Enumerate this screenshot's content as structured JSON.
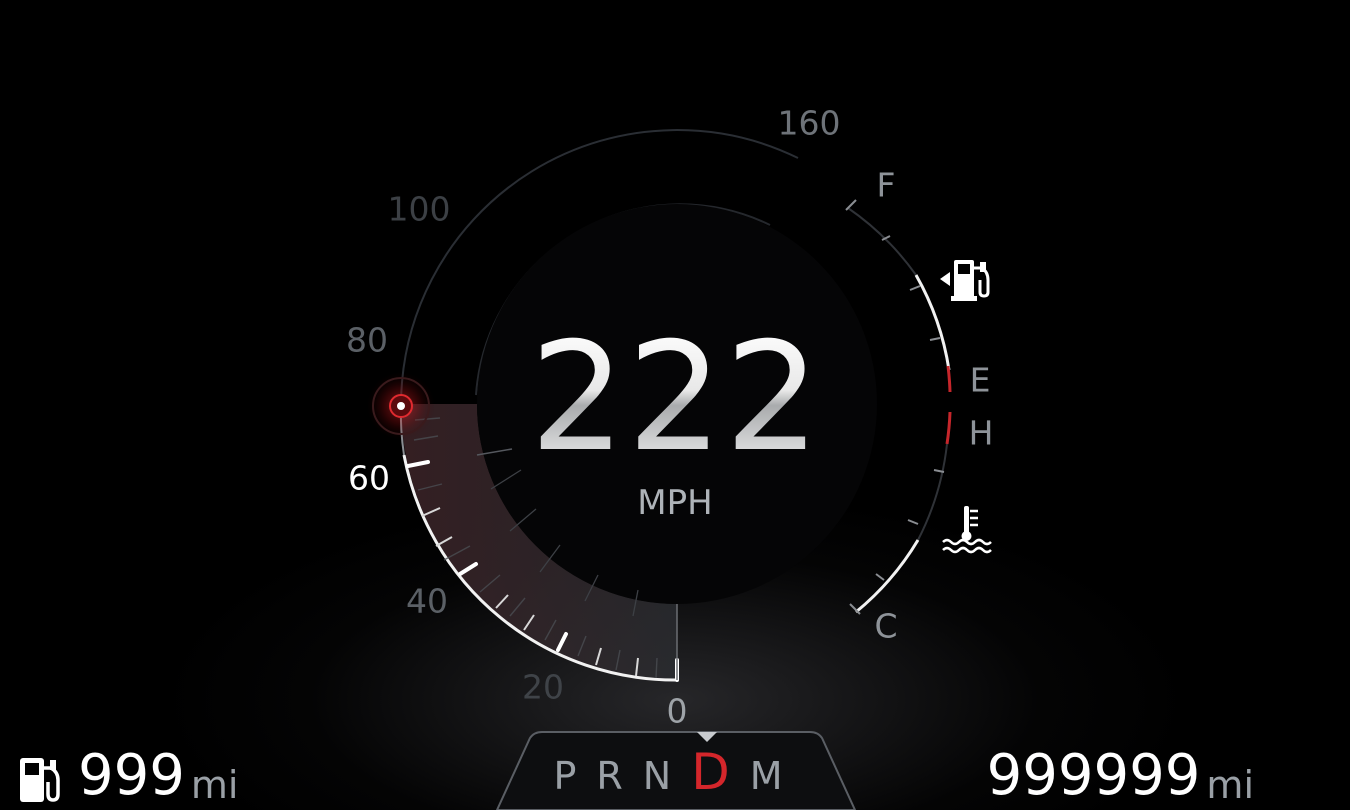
{
  "speedometer": {
    "speed_value": "222",
    "speed_unit": "MPH",
    "scale_labels": [
      "0",
      "20",
      "40",
      "60",
      "80",
      "100",
      "160"
    ],
    "needle_indicator": "60-mark"
  },
  "fuel_temp_gauge": {
    "fuel_full_label": "F",
    "fuel_empty_label": "E",
    "temp_hot_label": "H",
    "temp_cold_label": "C",
    "fuel_icon": "fuel-pump-icon",
    "temp_icon": "coolant-temperature-icon"
  },
  "gear_selector": {
    "gears": [
      "P",
      "R",
      "N",
      "D",
      "M"
    ],
    "active_gear": "D"
  },
  "range": {
    "value": "999",
    "unit": "mi",
    "icon": "fuel-pump-icon"
  },
  "odometer": {
    "value": "999999",
    "unit": "mi"
  },
  "colors": {
    "accent_red": "#d4262b",
    "text_white": "#ffffff",
    "text_grey": "#9aa0a6"
  }
}
